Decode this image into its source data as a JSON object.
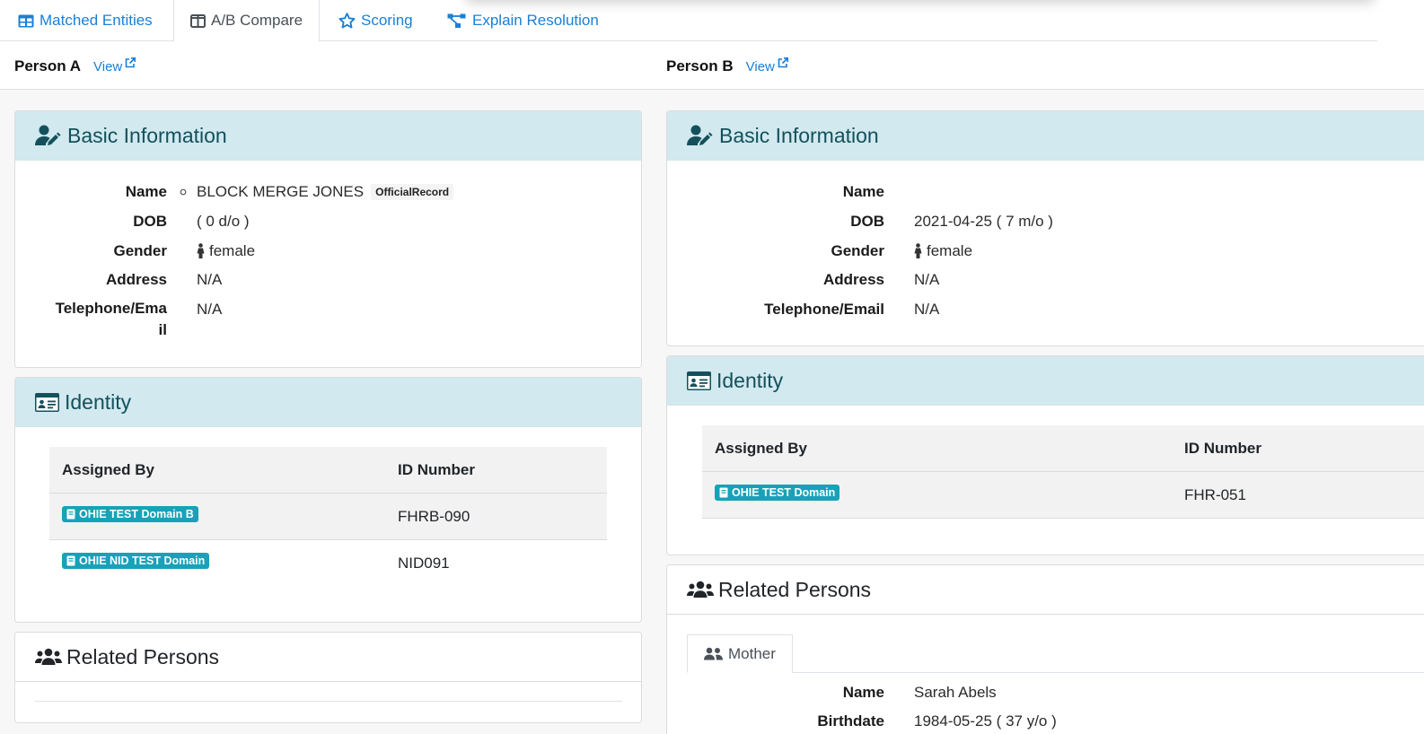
{
  "tabs": [
    {
      "label": "Matched Entities",
      "icon": "table-icon"
    },
    {
      "label": "A/B Compare",
      "icon": "columns-icon"
    },
    {
      "label": "Scoring",
      "icon": "star-icon"
    },
    {
      "label": "Explain Resolution",
      "icon": "sitemap-icon"
    }
  ],
  "personA": {
    "title": "Person A",
    "view": "View",
    "basic": {
      "header": "Basic Information",
      "labels": {
        "name": "Name",
        "dob": "DOB",
        "gender": "Gender",
        "address": "Address",
        "telephone1": "Telephone/Ema",
        "telephone2": "il"
      },
      "name": "BLOCK MERGE JONES",
      "name_badge": "OfficialRecord",
      "dob": "( 0 d/o )",
      "gender": "female",
      "address": "N/A",
      "telephone": "N/A"
    },
    "identity": {
      "header": "Identity",
      "col_assigned": "Assigned By",
      "col_id": "ID Number",
      "rows": [
        {
          "domain": "OHIE TEST Domain B",
          "id": "FHRB-090"
        },
        {
          "domain": "OHIE NID TEST Domain",
          "id": "NID091"
        }
      ]
    },
    "related": {
      "header": "Related Persons"
    }
  },
  "personB": {
    "title": "Person B",
    "view": "View",
    "basic": {
      "header": "Basic Information",
      "labels": {
        "name": "Name",
        "dob": "DOB",
        "gender": "Gender",
        "address": "Address",
        "telephone": "Telephone/Email"
      },
      "name": "",
      "dob": "2021-04-25 ( 7 m/o )",
      "gender": "female",
      "address": "N/A",
      "telephone": "N/A"
    },
    "identity": {
      "header": "Identity",
      "col_assigned": "Assigned By",
      "col_id": "ID Number",
      "rows": [
        {
          "domain": "OHIE TEST Domain",
          "id": "FHR-051"
        }
      ]
    },
    "related": {
      "header": "Related Persons",
      "tab": "Mother",
      "labels": {
        "name": "Name",
        "birthdate": "Birthdate"
      },
      "name": "Sarah Abels",
      "birthdate": "1984-05-25 ( 37 y/o )"
    }
  },
  "colors": {
    "accent": "#1a7fd6",
    "header_bg": "#d1e9ef",
    "header_text": "#14505c",
    "badge": "#17a2b8"
  }
}
